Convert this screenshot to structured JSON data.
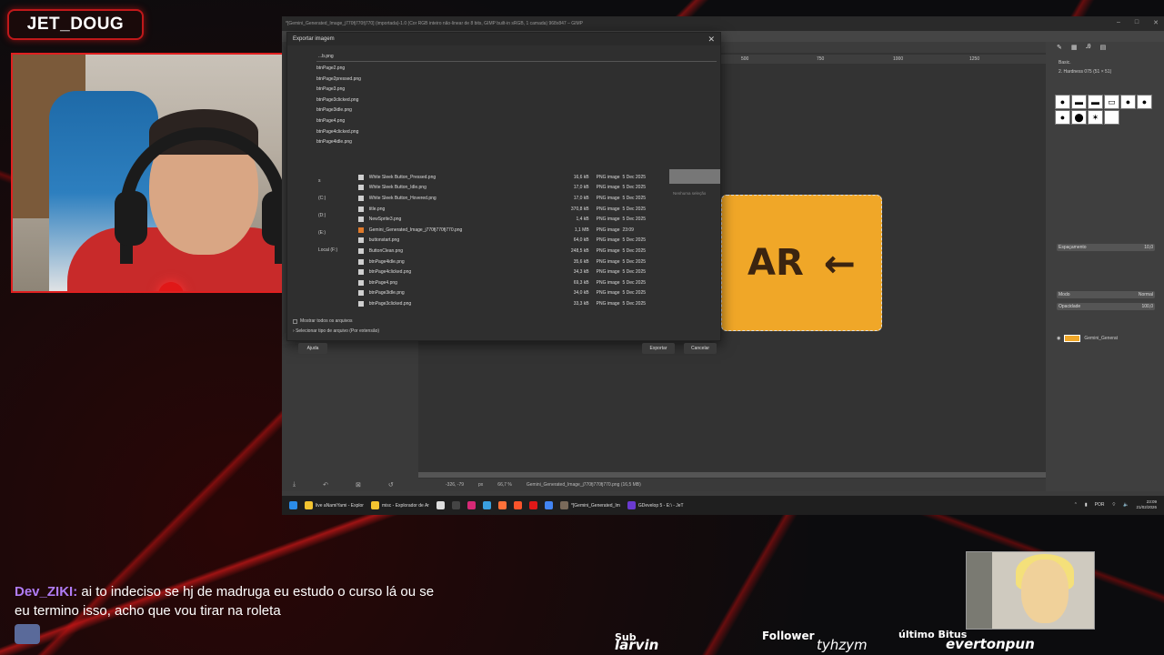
{
  "overlay": {
    "streamer_name": "JET_DOUG",
    "chat": {
      "user": "Dev_ZIKI:",
      "message": "ai to indeciso se hj de madruga eu estudo o curso lá ou se eu termino isso, acho que vou tirar na roleta"
    },
    "sub_label": "Sub",
    "sub_name": "larvin",
    "follower_label": "Follower",
    "follower_name": "tyhzym",
    "bits_label": "último Bitus",
    "bits_name": "evertonpun"
  },
  "gimp": {
    "window_title": "*[Gemini_Generated_Image_j770fj770fj770] (importada)-1.0 (Cor RGB inteiro não-linear de 8 bits, GIMP built-in sRGB, 1 camada) 968x847 – GIMP",
    "ruler_ticks": [
      "500",
      "750",
      "1000",
      "1250"
    ],
    "canvas_text": "AR",
    "status": {
      "coords": "-326, -79",
      "unit": "px",
      "zoom": "66,7 %",
      "info": "Gemini_Generated_Image_j770fj770fj770.png (16,5 MB)"
    },
    "right_dock": {
      "brush_set": "Basic.",
      "brush_name": "2. Hardness 075 (51 × 51)",
      "spacing_label": "Espaçamento",
      "spacing_value": "10,0",
      "mode_label": "Modo",
      "mode_value": "Normal",
      "opacity_label": "Opacidade",
      "opacity_value": "100,0",
      "layer_name": "Gemini_Generat"
    }
  },
  "dialog": {
    "title": "Exportar imagem",
    "filename": "...b.png",
    "recent_files": [
      "btnPage2.png",
      "btnPage2pressed.png",
      "btnPage3.png",
      "btnPage3clicked.png",
      "btnPage3idle.png",
      "btnPage4.png",
      "btnPage4clicked.png",
      "btnPage4idle.png"
    ],
    "places": [
      "s",
      "(C:)",
      "(D:)",
      "(E:)",
      "Local (F:)"
    ],
    "files": [
      {
        "name": "White Sleek Button_Pressed.png",
        "size": "16,6 kB",
        "type": "PNG image",
        "date": "5 Dec 2025"
      },
      {
        "name": "White Sleek Button_Idle.png",
        "size": "17,0 kB",
        "type": "PNG image",
        "date": "5 Dec 2025"
      },
      {
        "name": "White Sleek Button_Hovered.png",
        "size": "17,0 kB",
        "type": "PNG image",
        "date": "5 Dec 2025"
      },
      {
        "name": "title.png",
        "size": "370,8 kB",
        "type": "PNG image",
        "date": "5 Dec 2025"
      },
      {
        "name": "NewSprite3.png",
        "size": "1,4 kB",
        "type": "PNG image",
        "date": "5 Dec 2025"
      },
      {
        "name": "Gemini_Generated_Image_j770fj770fj770.png",
        "size": "1,1 MB",
        "type": "PNG image",
        "date": "23:09"
      },
      {
        "name": "buttonstart.png",
        "size": "64,0 kB",
        "type": "PNG image",
        "date": "5 Dec 2025"
      },
      {
        "name": "ButtonClean.png",
        "size": "248,5 kB",
        "type": "PNG image",
        "date": "5 Dec 2025"
      },
      {
        "name": "btnPage4idle.png",
        "size": "35,6 kB",
        "type": "PNG image",
        "date": "5 Dec 2025"
      },
      {
        "name": "btnPage4clicked.png",
        "size": "34,3 kB",
        "type": "PNG image",
        "date": "5 Dec 2025"
      },
      {
        "name": "btnPage4.png",
        "size": "69,3 kB",
        "type": "PNG image",
        "date": "5 Dec 2025"
      },
      {
        "name": "btnPage3idle.png",
        "size": "34,0 kB",
        "type": "PNG image",
        "date": "5 Dec 2025"
      },
      {
        "name": "btnPage3clicked.png",
        "size": "33,3 kB",
        "type": "PNG image",
        "date": "5 Dec 2025"
      }
    ],
    "preview_text": "Nenhuma seleção",
    "show_all": "Mostrar todos os arquivos",
    "file_type": "Selecionar tipo de arquivo (Por extensão)",
    "help_button": "Ajuda",
    "export_button": "Exportar",
    "cancel_button": "Cancelar"
  },
  "taskbar": {
    "items": [
      "live aNamiYami - Explor",
      "misc - Explorador de Ar",
      "*[Gemini_Generated_Im",
      "GDevelop 5 - E:\\ - JeT"
    ],
    "lang": "POR",
    "time": "23:09",
    "date": "21/02/2026"
  }
}
